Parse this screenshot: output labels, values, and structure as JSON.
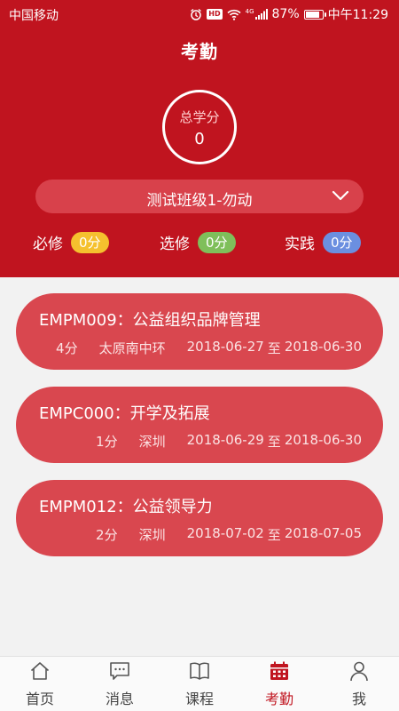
{
  "status_bar": {
    "carrier": "中国移动",
    "network": "4G",
    "battery": "87%",
    "battery_level": 0.87,
    "time": "中午11:29"
  },
  "header": {
    "title": "考勤",
    "total_score_label": "总学分",
    "total_score_value": "0",
    "class_selector": "测试班级1-勿动",
    "credits": [
      {
        "label": "必修",
        "value": "0分",
        "color": "#f5c12e"
      },
      {
        "label": "选修",
        "value": "0分",
        "color": "#7fbf5a"
      },
      {
        "label": "实践",
        "value": "0分",
        "color": "#6b8fe0"
      }
    ]
  },
  "courses": [
    {
      "title": "EMPM009：公益组织品牌管理",
      "credit": "4分",
      "location": "太原南中环",
      "start": "2018-06-27",
      "sep": "至",
      "end": "2018-06-30"
    },
    {
      "title": "EMPC000：开学及拓展",
      "credit": "1分",
      "location": "深圳",
      "start": "2018-06-29",
      "sep": "至",
      "end": "2018-06-30"
    },
    {
      "title": "EMPM012：公益领导力",
      "credit": "2分",
      "location": "深圳",
      "start": "2018-07-02",
      "sep": "至",
      "end": "2018-07-05"
    }
  ],
  "tabbar": {
    "tabs": [
      {
        "label": "首页",
        "icon": "home-icon"
      },
      {
        "label": "消息",
        "icon": "message-icon"
      },
      {
        "label": "课程",
        "icon": "book-icon"
      },
      {
        "label": "考勤",
        "icon": "calendar-icon",
        "active": true
      },
      {
        "label": "我",
        "icon": "person-icon"
      }
    ],
    "active_color": "#c0141f"
  },
  "colors": {
    "brand_red": "#c0141f",
    "card_red": "#d9474f"
  }
}
